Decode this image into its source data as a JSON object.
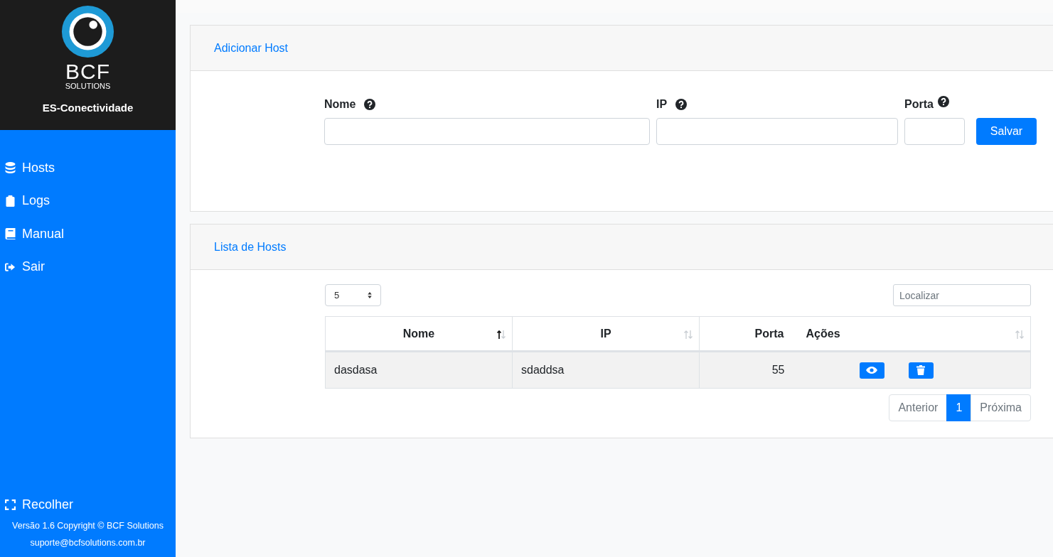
{
  "sidebar": {
    "brand": {
      "logo_main": "BCF",
      "logo_sub": "SOLUTIONS",
      "app_name": "ES-Conectividade"
    },
    "items": [
      {
        "kind": "hosts",
        "label": "Hosts"
      },
      {
        "kind": "logs",
        "label": "Logs"
      },
      {
        "kind": "manual",
        "label": "Manual"
      },
      {
        "kind": "exit",
        "label": "Sair"
      }
    ],
    "collapse": {
      "label": "Recolher"
    },
    "footer": {
      "version": "Versão 1.6 Copyright © BCF Solutions",
      "email": "suporte@bcfsolutions.com.br"
    }
  },
  "add_host": {
    "title": "Adicionar Host",
    "fields": [
      {
        "label": "Nome"
      },
      {
        "label": "IP"
      },
      {
        "label": "Porta"
      }
    ],
    "save_button": "Salvar"
  },
  "host_list": {
    "title": "Lista de Hosts",
    "page_size": "5",
    "search": {
      "placeholder": "Localizar"
    },
    "table": {
      "columns": [
        {
          "label": "Nome",
          "sortable": true,
          "sorted": true
        },
        {
          "label": "IP",
          "sortable": true,
          "sorted": false
        },
        {
          "label": "Porta",
          "sortable": false,
          "sorted": false
        },
        {
          "label": "Ações",
          "sortable": true,
          "sorted": false
        }
      ],
      "rows": [
        {
          "nome": "dasdasa",
          "ip": "sdaddsa",
          "porta": "55"
        }
      ]
    },
    "pagination": {
      "previous": "Anterior",
      "pages": [
        {
          "label": "1",
          "selected": true
        }
      ],
      "next": "Próxima"
    }
  }
}
